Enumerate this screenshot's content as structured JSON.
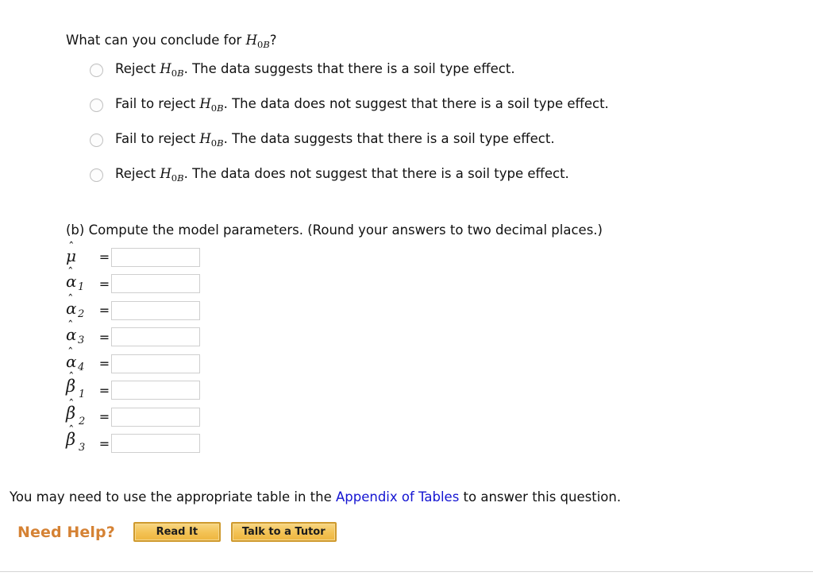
{
  "question": {
    "prompt_prefix": "What can you conclude for ",
    "prompt_symbol": "H",
    "prompt_symbol_sub": "0B",
    "prompt_suffix": "?",
    "options": [
      {
        "prefix": "Reject ",
        "symbol": "H",
        "symbol_sub": "0B",
        "suffix": ". The data suggests that there is a soil type effect.",
        "selected": false
      },
      {
        "prefix": "Fail to reject ",
        "symbol": "H",
        "symbol_sub": "0B",
        "suffix": ". The data does not suggest that there is a soil type effect.",
        "selected": false
      },
      {
        "prefix": "Fail to reject ",
        "symbol": "H",
        "symbol_sub": "0B",
        "suffix": ". The data suggests that there is a soil type effect.",
        "selected": false
      },
      {
        "prefix": "Reject ",
        "symbol": "H",
        "symbol_sub": "0B",
        "suffix": ". The data does not suggest that there is a soil type effect.",
        "selected": false
      }
    ]
  },
  "part_b": {
    "instruction": "(b) Compute the model parameters. (Round your answers to two decimal places.)",
    "equals": "=",
    "parameters": [
      {
        "symbol": "μ",
        "subscript": "",
        "kind": "mu",
        "value": ""
      },
      {
        "symbol": "α",
        "subscript": "1",
        "kind": "alpha",
        "value": ""
      },
      {
        "symbol": "α",
        "subscript": "2",
        "kind": "alpha",
        "value": ""
      },
      {
        "symbol": "α",
        "subscript": "3",
        "kind": "alpha",
        "value": ""
      },
      {
        "symbol": "α",
        "subscript": "4",
        "kind": "alpha",
        "value": ""
      },
      {
        "symbol": "β",
        "subscript": "1",
        "kind": "beta",
        "value": ""
      },
      {
        "symbol": "β",
        "subscript": "2",
        "kind": "beta",
        "value": ""
      },
      {
        "symbol": "β",
        "subscript": "3",
        "kind": "beta",
        "value": ""
      }
    ],
    "hat": "ˆ",
    "input_placeholder": ""
  },
  "footnote": {
    "before_link": "You may need to use the appropriate table in the ",
    "link_text": "Appendix of Tables",
    "after_link": " to answer this question."
  },
  "help": {
    "label": "Need Help?",
    "read_it_label": "Read It",
    "talk_tutor_label": "Talk to a Tutor"
  },
  "colors": {
    "link": "#1414d2",
    "need_help": "#d58234",
    "button_border": "#cf9a2e",
    "button_fill": "#f3c254",
    "rule": "#d4d4d4"
  }
}
